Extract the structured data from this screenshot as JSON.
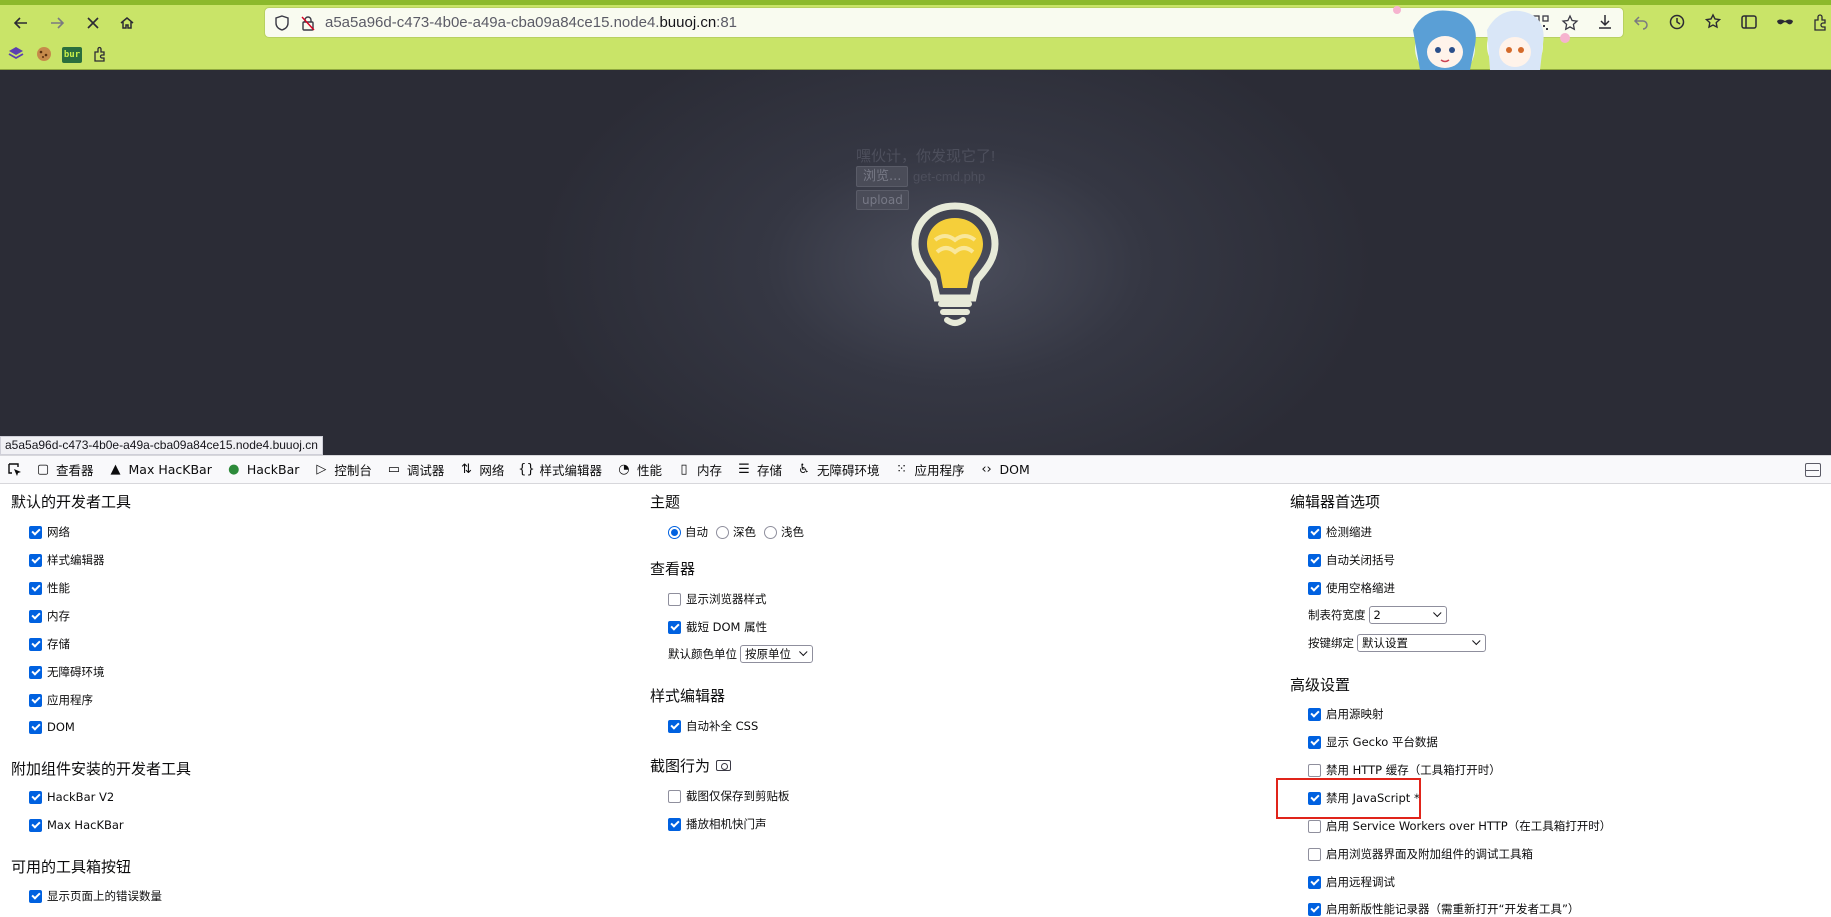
{
  "browser": {
    "url_prefix": "a5a5a96d-c473-4b0e-a49a-cba09a84ce15.node4.",
    "url_host": "buuoj.cn",
    "url_suffix": ":81",
    "bookmark_bur_label": "bur",
    "status_url": "a5a5a96d-c473-4b0e-a49a-cba09a84ce15.node4.buuoj.cn"
  },
  "page": {
    "message": "嘿伙计，你发现它了!",
    "browse_label": "浏览...",
    "file_name": "get-cmd.php",
    "upload_label": "upload"
  },
  "devtools": {
    "tabs": [
      "查看器",
      "Max HacKBar",
      "HackBar",
      "控制台",
      "调试器",
      "网络",
      "样式编辑器",
      "性能",
      "内存",
      "存储",
      "无障碍环境",
      "应用程序",
      "DOM"
    ],
    "col1": {
      "title": "默认的开发者工具",
      "tools": [
        {
          "label": "网络",
          "checked": true
        },
        {
          "label": "样式编辑器",
          "checked": true
        },
        {
          "label": "性能",
          "checked": true
        },
        {
          "label": "内存",
          "checked": true
        },
        {
          "label": "存储",
          "checked": true
        },
        {
          "label": "无障碍环境",
          "checked": true
        },
        {
          "label": "应用程序",
          "checked": true
        },
        {
          "label": "DOM",
          "checked": true
        }
      ],
      "addon_title": "附加组件安装的开发者工具",
      "addons": [
        {
          "label": "HackBar V2",
          "checked": true
        },
        {
          "label": "Max HacKBar",
          "checked": true
        }
      ],
      "buttons_title": "可用的工具箱按钮",
      "buttons": [
        {
          "label": "显示页面上的错误数量",
          "checked": true
        }
      ]
    },
    "col2": {
      "theme_title": "主题",
      "theme_options": [
        {
          "label": "自动",
          "selected": true
        },
        {
          "label": "深色",
          "selected": false
        },
        {
          "label": "浅色",
          "selected": false
        }
      ],
      "inspector_title": "查看器",
      "inspector_options": [
        {
          "label": "显示浏览器样式",
          "checked": false
        },
        {
          "label": "截短 DOM 属性",
          "checked": true
        }
      ],
      "color_unit_label": "默认颜色单位",
      "color_unit_value": "按原单位",
      "style_editor_title": "样式编辑器",
      "style_editor_options": [
        {
          "label": "自动补全 CSS",
          "checked": true
        }
      ],
      "screenshot_title": "截图行为",
      "screenshot_options": [
        {
          "label": "截图仅保存到剪贴板",
          "checked": false
        },
        {
          "label": "播放相机快门声",
          "checked": true
        }
      ]
    },
    "col3": {
      "editor_title": "编辑器首选项",
      "editor_options": [
        {
          "label": "检测缩进",
          "checked": true
        },
        {
          "label": "自动关闭括号",
          "checked": true
        },
        {
          "label": "使用空格缩进",
          "checked": true
        }
      ],
      "tab_size_label": "制表符宽度",
      "tab_size_value": "2",
      "keybinding_label": "按键绑定",
      "keybinding_value": "默认设置",
      "advanced_title": "高级设置",
      "advanced_options": [
        {
          "label": "启用源映射",
          "checked": true
        },
        {
          "label": "显示 Gecko 平台数据",
          "checked": true
        },
        {
          "label": "禁用 HTTP 缓存（工具箱打开时）",
          "checked": false
        },
        {
          "label": "禁用 JavaScript *",
          "checked": true
        },
        {
          "label": "启用 Service Workers over HTTP（在工具箱打开时）",
          "checked": false
        },
        {
          "label": "启用浏览器界面及附加组件的调试工具箱",
          "checked": false
        },
        {
          "label": "启用远程调试",
          "checked": true
        },
        {
          "label": "启用新版性能记录器（需重新打开“开发者工具”）",
          "checked": true
        }
      ]
    }
  }
}
